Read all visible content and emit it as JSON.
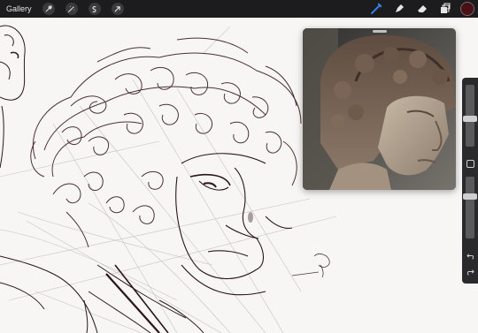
{
  "toolbar": {
    "gallery_label": "Gallery",
    "left_icons": [
      "wrench-icon",
      "magic-wand-icon",
      "selection-icon",
      "transform-arrow-icon"
    ],
    "right_icons": [
      "brush-icon",
      "smudge-icon",
      "eraser-icon",
      "layers-icon"
    ],
    "active_tool": "brush-icon",
    "brush_color": "#4a1016"
  },
  "reference_window": {
    "content": "photo-reference"
  },
  "sidebar": {
    "brush_size_level": 0.45,
    "opacity_level": 0.7,
    "icons": [
      "modify-square-icon",
      "undo-icon",
      "redo-icon"
    ]
  }
}
